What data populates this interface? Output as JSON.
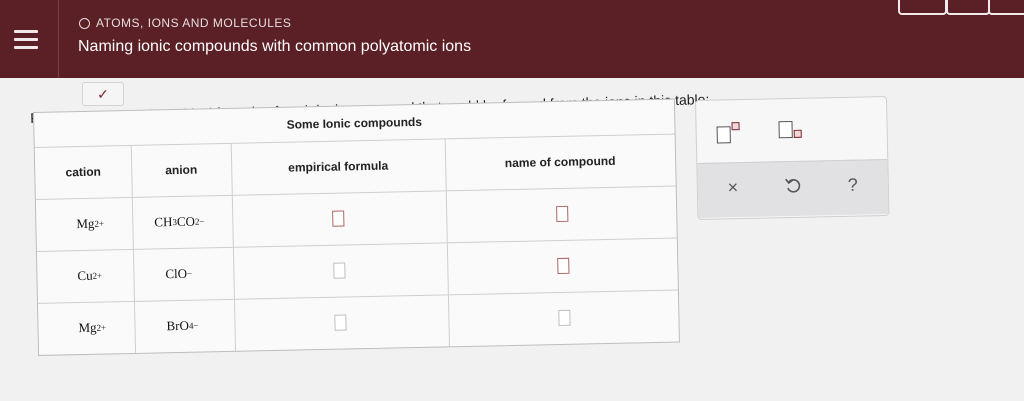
{
  "header": {
    "section": "ATOMS, IONS AND MOLECULES",
    "title": "Naming ionic compounds with common polyatomic ions"
  },
  "icons": {
    "menu": "hamburger-menu-icon",
    "section_marker": "ring-icon",
    "collapse": "chevron-down-icon",
    "superscript": "superscript-box-icon",
    "subscript": "subscript-box-icon",
    "clear": "x-icon",
    "undo": "undo-icon",
    "help": "question-icon"
  },
  "colors": {
    "header_bg": "#5b1f26",
    "accent": "#7b2a32"
  },
  "instructions": "Fill in the name and empirical formula of each ionic compound that could be formed from the ions in this table:",
  "table": {
    "caption": "Some Ionic compounds",
    "columns": [
      "cation",
      "anion",
      "empirical formula",
      "name of compound"
    ],
    "rows": [
      {
        "cation_symbol": "Mg",
        "cation_charge": "2+",
        "anion_html": "CH3CO2-"
      },
      {
        "cation_symbol": "Cu",
        "cation_charge": "2+",
        "anion_html": "ClO-"
      },
      {
        "cation_symbol": "Mg",
        "cation_charge": "2+",
        "anion_html": "BrO4-"
      }
    ]
  },
  "tools": {
    "clear": "×",
    "help": "?"
  }
}
